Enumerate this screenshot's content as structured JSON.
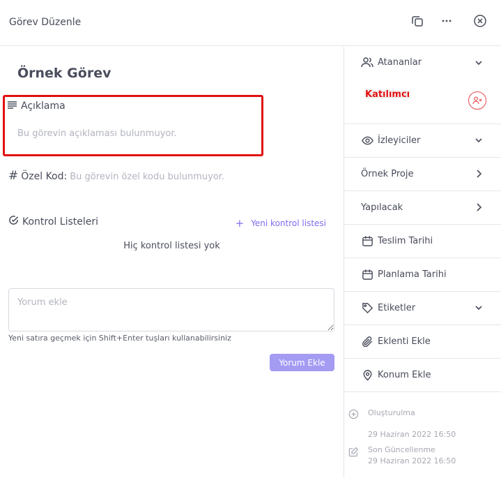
{
  "header": {
    "title": "Görev Düzenle",
    "actions": [
      "copy-icon",
      "more-icon",
      "close-icon"
    ]
  },
  "main": {
    "task_title": "Örnek Görev",
    "description": {
      "label": "Açıklama",
      "empty": "Bu görevin açıklaması bulunmuyor."
    },
    "custom_code": {
      "hash": "#",
      "label": "Özel Kod:",
      "empty": "Bu görevin özel kodu bulunmuyor."
    },
    "checklists": {
      "label": "Kontrol Listeleri",
      "add_icon": "+",
      "add_label": "Yeni kontrol listesi",
      "empty": "Hiç kontrol listesi yok"
    },
    "comment": {
      "placeholder": "Yorum ekle",
      "value": "",
      "hint": "Yeni satıra geçmek için Shift+Enter tuşları kullanabilirsiniz",
      "button": "Yorum Ekle"
    }
  },
  "sidebar": {
    "assignees": {
      "label": "Atananlar",
      "participant": "Katılımcı"
    },
    "items": [
      {
        "label": "İzleyiciler",
        "icon": "eye-icon",
        "trailing": "chevron-down"
      },
      {
        "label": "Örnek Proje",
        "icon": "",
        "trailing": "chevron-right"
      },
      {
        "label": "Yapılacak",
        "icon": "",
        "trailing": "chevron-right"
      },
      {
        "label": "Teslim Tarihi",
        "icon": "calendar-icon",
        "trailing": ""
      },
      {
        "label": "Planlama Tarihi",
        "icon": "calendar-icon",
        "trailing": ""
      },
      {
        "label": "Etiketler",
        "icon": "tag-icon",
        "trailing": "chevron-down"
      },
      {
        "label": "Eklenti Ekle",
        "icon": "paperclip-icon",
        "trailing": ""
      },
      {
        "label": "Konum Ekle",
        "icon": "location-pin-icon",
        "trailing": ""
      }
    ],
    "meta": {
      "created_label": "Oluşturulma",
      "created_date": "29 Haziran 2022 16:50",
      "updated_label": "Son Güncellenme",
      "updated_date": "29 Haziran 2022 16:50"
    }
  },
  "colors": {
    "highlight": "#e10f0f",
    "accent": "#7b6cf0",
    "button": "#a49bf3",
    "danger": "#e5484d"
  }
}
